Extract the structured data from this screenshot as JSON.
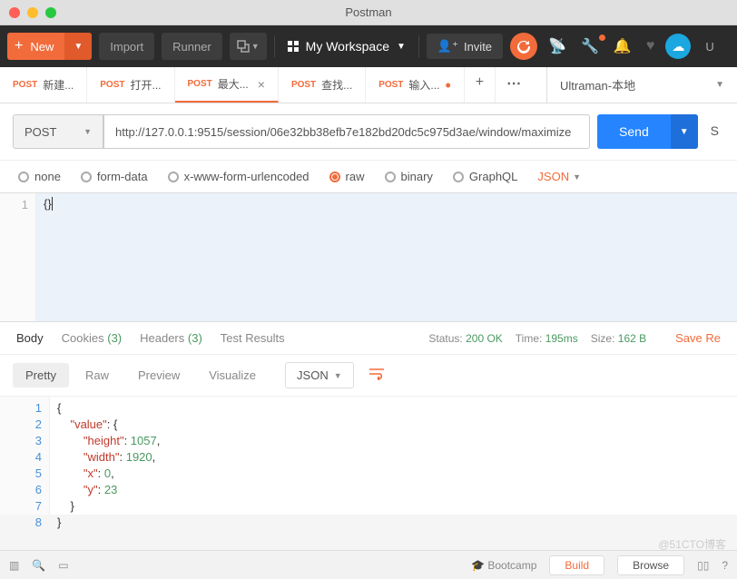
{
  "app": {
    "title": "Postman"
  },
  "toolbar": {
    "new_label": "New",
    "import_label": "Import",
    "runner_label": "Runner",
    "workspace_label": "My Workspace",
    "invite_label": "Invite",
    "right_cut": "U"
  },
  "tabs": [
    {
      "method": "POST",
      "label": "新建..."
    },
    {
      "method": "POST",
      "label": "打开..."
    },
    {
      "method": "POST",
      "label": "最大..."
    },
    {
      "method": "POST",
      "label": "查找..."
    },
    {
      "method": "POST",
      "label": "输入..."
    }
  ],
  "active_tab_index": 2,
  "environment": "Ultraman-本地",
  "request": {
    "method": "POST",
    "url": "http://127.0.0.1:9515/session/06e32bb38efb7e182bd20dc5c975d3ae/window/maximize",
    "send": "Send",
    "save_cut": "S"
  },
  "body_types": {
    "options": [
      "none",
      "form-data",
      "x-www-form-urlencoded",
      "raw",
      "binary",
      "GraphQL"
    ],
    "selected": "raw",
    "format": "JSON"
  },
  "request_body": {
    "line1": "{}",
    "line_number": "1"
  },
  "response_tabs": {
    "body": "Body",
    "cookies": "Cookies",
    "cookies_count": "(3)",
    "headers": "Headers",
    "headers_count": "(3)",
    "test_results": "Test Results"
  },
  "response_meta": {
    "status_label": "Status:",
    "status": "200 OK",
    "time_label": "Time:",
    "time": "195ms",
    "size_label": "Size:",
    "size": "162 B"
  },
  "save_response": "Save Re",
  "view_modes": {
    "pretty": "Pretty",
    "raw": "Raw",
    "preview": "Preview",
    "visualize": "Visualize",
    "json": "JSON"
  },
  "response_body": {
    "lines": [
      "1",
      "2",
      "3",
      "4",
      "5",
      "6",
      "7",
      "8"
    ],
    "value_key": "\"value\"",
    "height_key": "\"height\"",
    "height_val": "1057",
    "width_key": "\"width\"",
    "width_val": "1920",
    "x_key": "\"x\"",
    "x_val": "0",
    "y_key": "\"y\"",
    "y_val": "23"
  },
  "footer": {
    "bootcamp": "Bootcamp",
    "build": "Build",
    "browse": "Browse"
  },
  "watermark": "@51CTO博客"
}
